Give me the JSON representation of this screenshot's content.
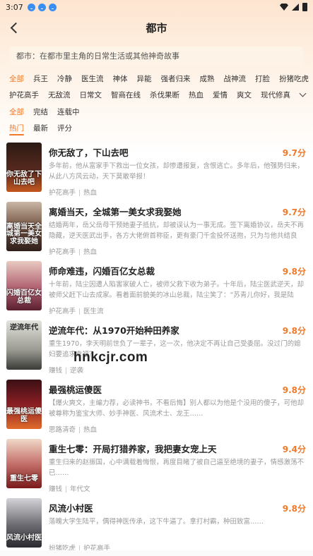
{
  "status": {
    "time": "3:07"
  },
  "header": {
    "title": "都市"
  },
  "description": "都市：在都市里主角的日常生活或其他神奇故事",
  "subcategories_row1": [
    "全部",
    "兵王",
    "冷静",
    "医生流",
    "神体",
    "异能",
    "强者归来",
    "成熟",
    "战神流",
    "打脸",
    "扮猪吃虎"
  ],
  "subcategories_row2": [
    "护花高手",
    "无敌流",
    "日常文",
    "智商在线",
    "杀伐果断",
    "热血",
    "爱情",
    "爽文",
    "现代修真"
  ],
  "status_filters": [
    "全部",
    "完结",
    "连载中"
  ],
  "sort_filters": [
    "热门",
    "最新",
    "评分"
  ],
  "watermark": "hnkcjr.com",
  "books": [
    {
      "title": "你无敌了，下山去吧",
      "score": "9.7分",
      "desc": "多年前，他从富家手下救出一位女孩，却惨遭报复，含恨逃亡。多年后，他强势归来，从此八方风云动，天下莫敢举报！",
      "tags": [
        "护花高手",
        "热血"
      ],
      "cover_text": "你无敌了下山去吧",
      "cover_color": "#5a2a1e"
    },
    {
      "title": "离婚当天，全城第一美女求我娶她",
      "score": "9.7分",
      "desc": "结婚两年，岳父岳母干预她妻子抵抗，却被误认为一事无成。签下离婚协议，岳夫不再隐藏，逆天医武出手，各方大佬俯首称臣，更有豪门千金投怀送抱，只为与他共结良缘……",
      "tags": [
        "护花高手",
        "热血"
      ],
      "cover_text": "离婚当天全城第一美女求我娶她",
      "cover_color": "#6b4a3a"
    },
    {
      "title": "师命难违，闪婚百亿女总裁",
      "score": "9.8分",
      "desc": "十年前，陆尘因遭人陷害家破人亡，被师父救下收为弟子。十年后，陆尘医武逆天，却被师父赶下山去成家。看着面前貌美的冰山总裁，陆尘笑了：“苏青儿你好，我是陆尘，你未来的……",
      "tags": [
        "护花高手",
        "医生流"
      ],
      "cover_text": "闪婚百亿女总裁",
      "cover_color": "#7a3a4a"
    },
    {
      "title": "逆流年代：从1970开始种田养家",
      "score": "9.8分",
      "desc": "重生1970，李天明前世负了一辈子，这一次，他决定不再让自己受委屈。没过门的媳妇要追求幸福？",
      "tags": [
        "赚钱",
        "逆袭"
      ],
      "cover_text": "逆流年代",
      "cover_color": "#9a9a92"
    },
    {
      "title": "最强桃运傻医",
      "score": "9.8分",
      "desc": "【爆火爽文，主编力荐，必读神书，不看后悔】别人都以为他是个没用的傻子，可他却被尊称为鉴宝大师、妙手神医、风流术士、龙王……",
      "tags": [
        "思路清奇",
        "热血"
      ],
      "cover_text": "最强桃运傻医",
      "cover_color": "#8a1e24"
    },
    {
      "title": "重生七零：开局打猎养家，我把妻女宠上天",
      "score": "9.4分",
      "desc": "重生归来的赵振国，心中满载着悔恨，再度目睹了被自己逼至绝境的妻子，情感激荡不已……",
      "tags": [
        "赚钱",
        "年代文"
      ],
      "cover_text": "重生七零",
      "cover_color": "#a33a3a"
    },
    {
      "title": "风流小村医",
      "score": "9.8分",
      "desc": "落魄大学生陆平，偶得神医传承，这下牛逼了。拿打村霸，种田致富……",
      "tags": [
        "扮猪吃虎",
        "护花高手"
      ],
      "cover_text": "风流小村医",
      "cover_color": "#6a6a70"
    }
  ]
}
